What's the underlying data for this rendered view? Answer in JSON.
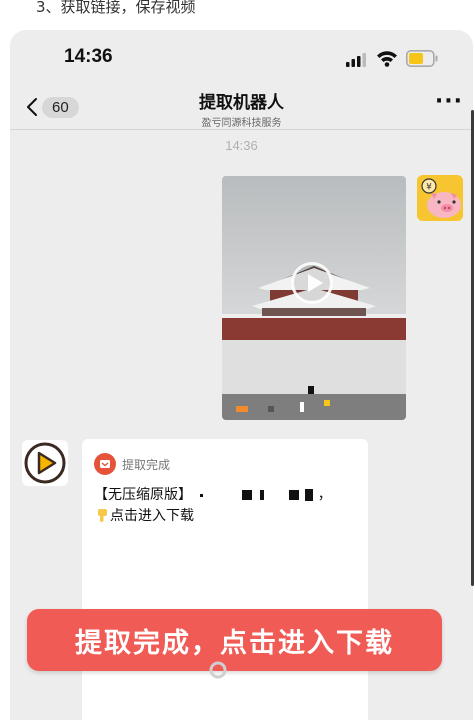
{
  "caption": "3、获取链接，保存视频",
  "status_bar": {
    "time": "14:36",
    "signal_icon": "cellular-signal-icon",
    "wifi_icon": "wifi-icon",
    "battery_icon": "battery-icon",
    "battery_color": "#f5c518"
  },
  "nav": {
    "back_icon": "chevron-left-icon",
    "unread_count": "60",
    "title": "提取机器人",
    "subtitle": "盈亏同源科技服务",
    "more_icon": "more-dots-icon",
    "more_label": "···"
  },
  "chat": {
    "timestamp": "14:36",
    "user_avatar_icon": "pig-avatar-icon",
    "video_message": {
      "play_icon": "play-icon"
    },
    "bot_avatar_icon": "bot-play-icon",
    "result_card": {
      "status_icon": "extract-complete-icon",
      "status_label": "提取完成",
      "line1_prefix": "【无压缩原版】",
      "line1_suffix": "，",
      "line2_icon": "pointing-down-hand-icon",
      "line2_text": "点击进入下载"
    }
  },
  "banner": {
    "text": "提取完成，点击进入下载",
    "color": "#f05b55"
  }
}
